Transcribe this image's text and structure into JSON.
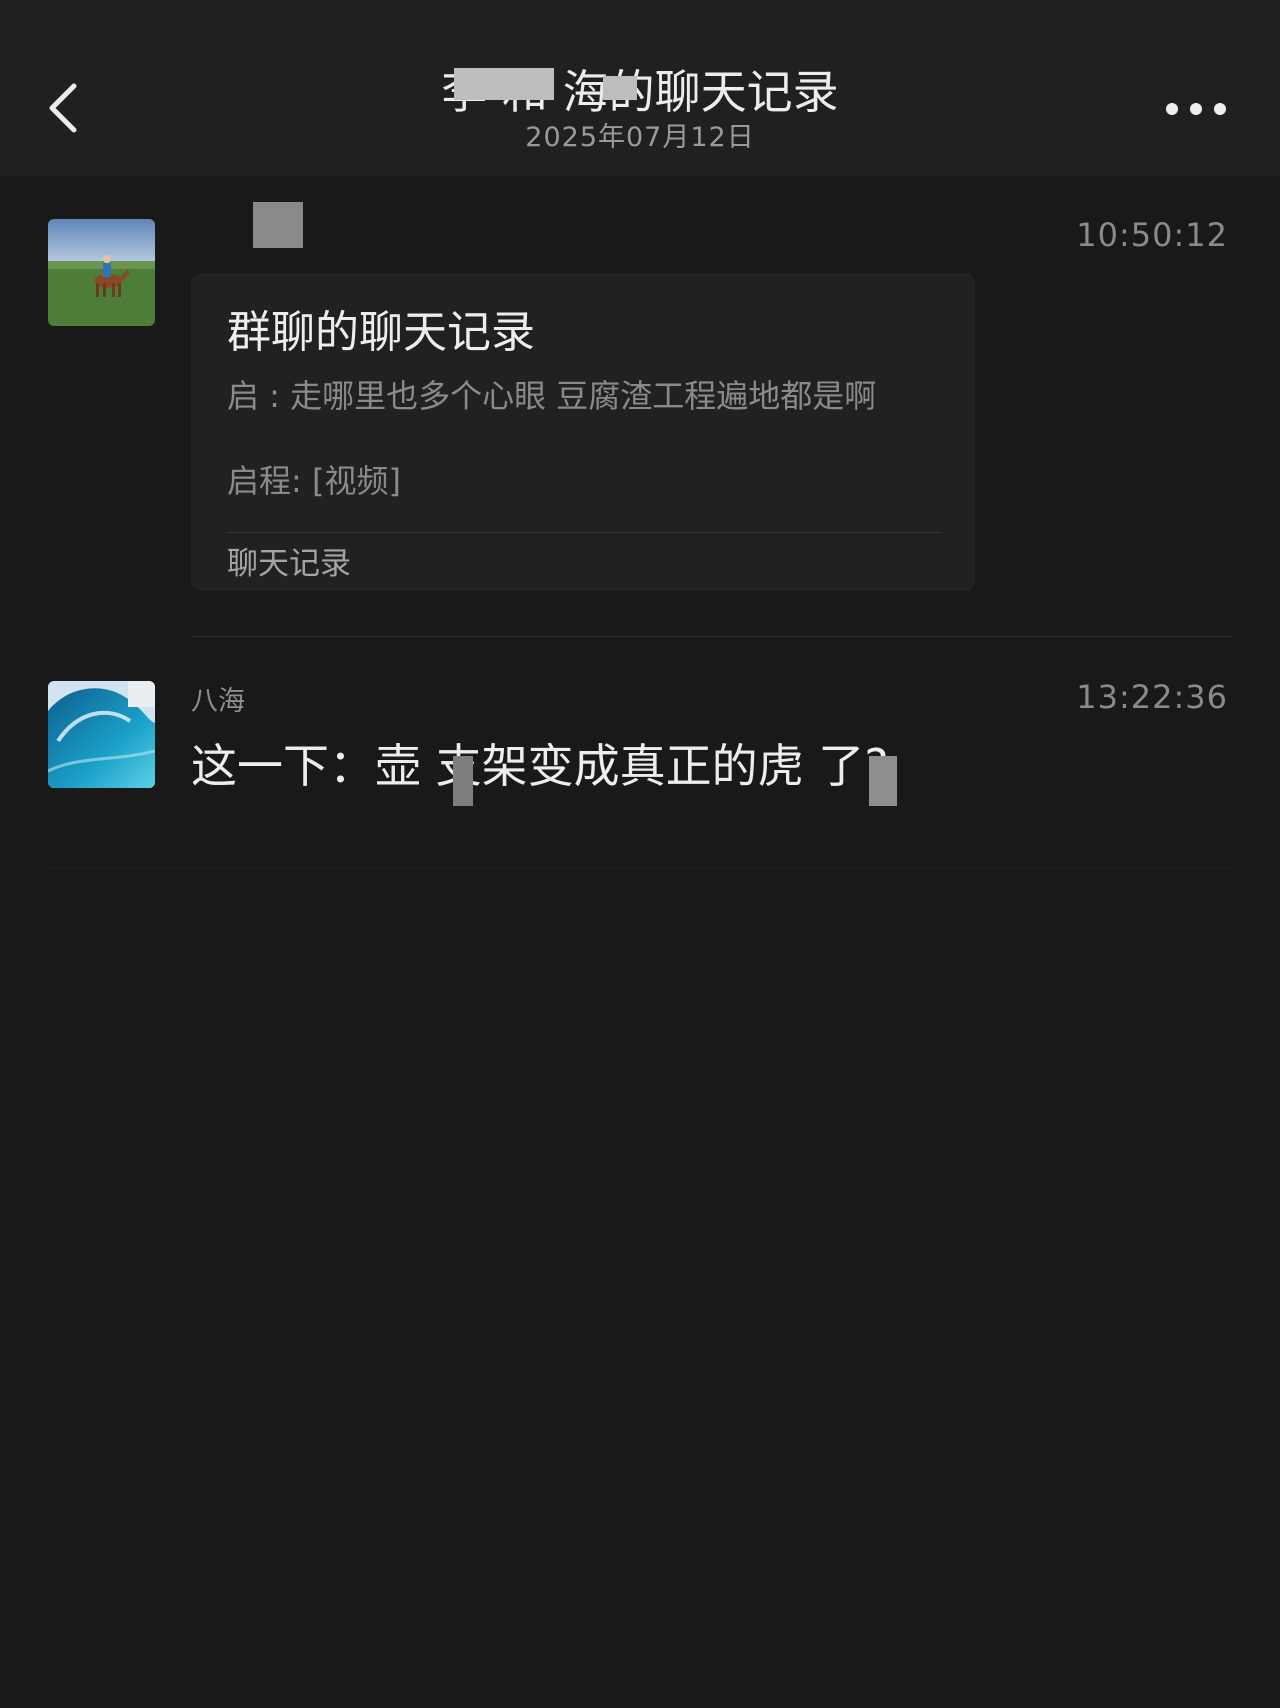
{
  "header": {
    "back_icon": "chevron-left-icon",
    "title": "李   和  海的聊天记录",
    "date": "2025年07月12日",
    "more_icon": "more-horizontal-icon"
  },
  "messages": [
    {
      "sender": "",
      "time": "10:50:12",
      "avatar_icon": "horse-rider-avatar",
      "card": {
        "title": "群聊的聊天记录",
        "lines": [
          "启  : 走哪里也多个心眼 豆腐渣工程遍地都是啊",
          "启程: [视频]"
        ],
        "footer": "聊天记录"
      }
    },
    {
      "sender": "八海",
      "time": "13:22:36",
      "avatar_icon": "ocean-wave-avatar",
      "text": "这一下：壶  支架变成真正的虎  了?"
    }
  ],
  "colors": {
    "background": "#191919",
    "header_background": "#202020",
    "card_background": "#212121",
    "primary_text": "#ededed",
    "secondary_text": "#8a8a8a"
  }
}
